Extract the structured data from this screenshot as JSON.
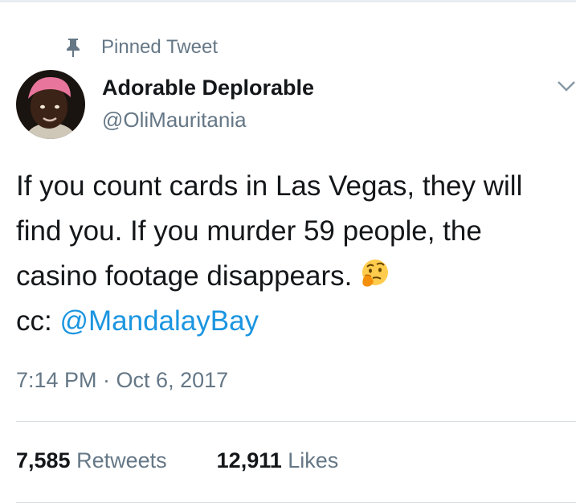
{
  "pinned": {
    "label": "Pinned Tweet",
    "icon": "pin-icon"
  },
  "author": {
    "name": "Adorable Deplorable",
    "handle": "@OliMauritania",
    "avatar_icon": "avatar"
  },
  "menu": {
    "icon": "chevron-down-icon"
  },
  "tweet": {
    "lines": [
      "If you count cards in Las Vegas, they will",
      "find you. If you murder 59 people, the",
      "casino footage disappears."
    ],
    "emoji": "thinking-face",
    "cc_prefix": "cc: ",
    "mention": "@MandalayBay"
  },
  "timestamp": "7:14 PM · Oct 6, 2017",
  "stats": {
    "retweets_count": "7,585",
    "retweets_label": "Retweets",
    "likes_count": "12,911",
    "likes_label": "Likes"
  },
  "colors": {
    "text": "#14171a",
    "secondary": "#657786",
    "link": "#1b95e0",
    "divider": "#d6dde3"
  }
}
